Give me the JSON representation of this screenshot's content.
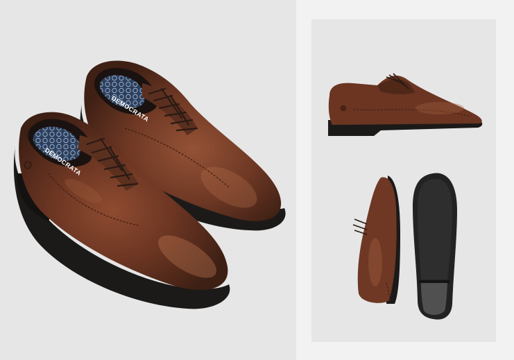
{
  "gallery": {
    "main_image": {
      "label": "Pair of brown leather derby shoes, top view",
      "insole_brand": "DEMOCRATA"
    },
    "side_image": {
      "label": "Side view of shoe"
    },
    "detail_image": {
      "label": "Shoe profile and outsole"
    }
  },
  "colors": {
    "leather": "#5a2f1f",
    "leather_highlight": "#8a4a30",
    "sole": "#1c1a19",
    "insole_pattern": "#3b4f6e",
    "background": "#e6e6e6"
  }
}
